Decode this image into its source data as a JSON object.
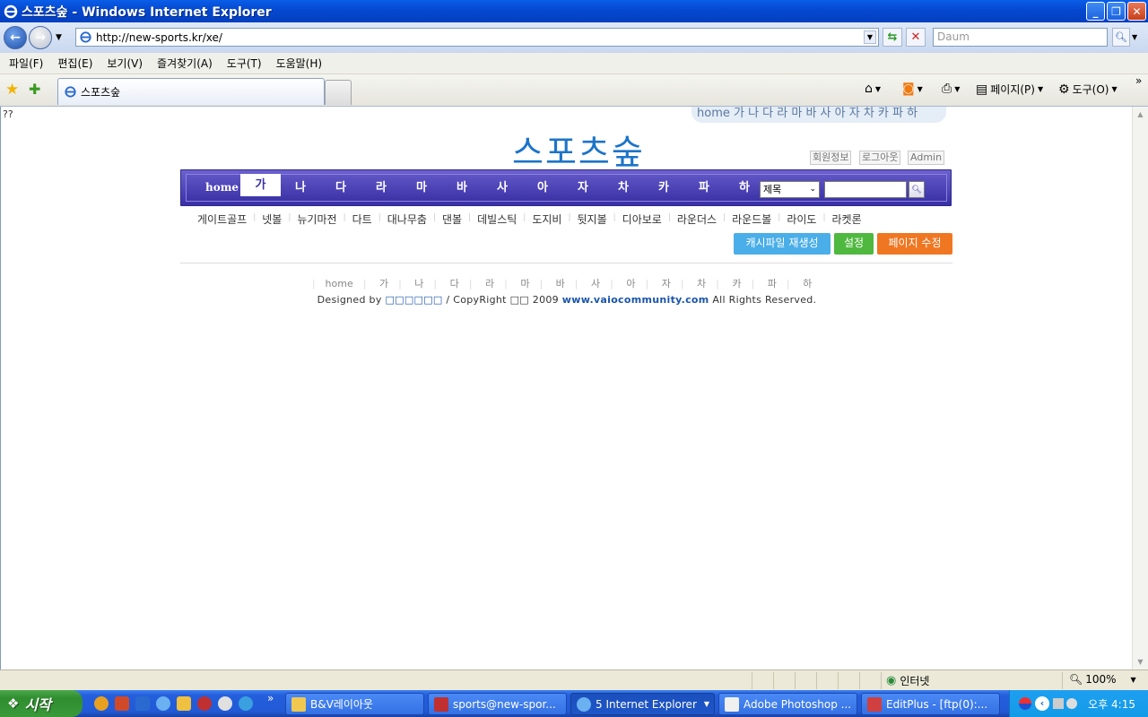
{
  "window": {
    "title": "스포츠숲 - Windows Internet Explorer"
  },
  "address": {
    "url": "http://new-sports.kr/xe/",
    "search_placeholder": "Daum"
  },
  "menu": [
    "파일(F)",
    "편집(E)",
    "보기(V)",
    "즐겨찾기(A)",
    "도구(T)",
    "도움말(H)"
  ],
  "tab": {
    "title": "스포츠숲"
  },
  "commands": {
    "page": "페이지(P)",
    "tools": "도구(O)"
  },
  "page": {
    "corner_text": "??",
    "top_nav": "home 가 나 다 라 마 바 사 아 자 차 카 파 하",
    "logo": "스포츠숲",
    "user_buttons": [
      "회원정보",
      "로그아웃",
      "Admin"
    ],
    "main_nav": [
      "home",
      "가",
      "나",
      "다",
      "라",
      "마",
      "바",
      "사",
      "아",
      "자",
      "차",
      "카",
      "파",
      "하"
    ],
    "active_nav": "가",
    "search_select": "제목",
    "sub_nav": [
      "게이트골프",
      "넷볼",
      "뉴기마전",
      "다트",
      "대나무춤",
      "댄볼",
      "데빌스틱",
      "도지비",
      "뒷지볼",
      "디아보로",
      "라운더스",
      "라운드볼",
      "라이도",
      "라켓론"
    ],
    "action_buttons": [
      {
        "label": "캐시파일 재생성",
        "color": "#4aaee8"
      },
      {
        "label": "설정",
        "color": "#4fb83f"
      },
      {
        "label": "페이지 수정",
        "color": "#f07722"
      }
    ],
    "footer_nav": [
      "home",
      "가",
      "나",
      "다",
      "라",
      "마",
      "바",
      "사",
      "아",
      "자",
      "차",
      "카",
      "파",
      "하"
    ],
    "copyright": {
      "prefix": "Designed by",
      "designer": "□□□□□□",
      "middle": "/ CopyRight □□ 2009",
      "site": "www.vaiocommunity.com",
      "suffix": "All Rights Reserved."
    }
  },
  "status": {
    "zone": "인터넷",
    "zoom": "100%"
  },
  "taskbar": {
    "start": "시작",
    "tasks": [
      "B&V레이아웃",
      "sports@new-spor...",
      "5 Internet Explorer",
      "Adobe Photoshop ...",
      "EditPlus - [ftp(0):..."
    ],
    "clock": "오후 4:15"
  }
}
